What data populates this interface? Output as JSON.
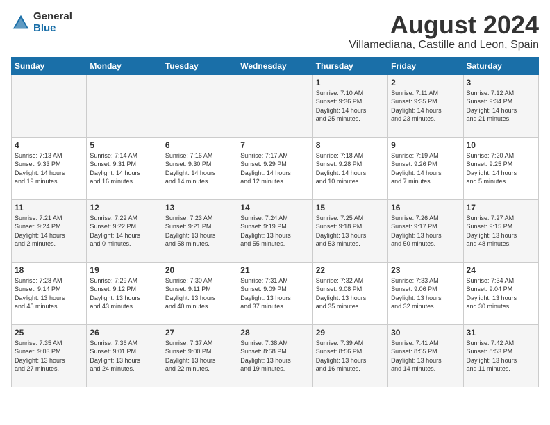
{
  "logo": {
    "general": "General",
    "blue": "Blue"
  },
  "title": {
    "month_year": "August 2024",
    "location": "Villamediana, Castille and Leon, Spain"
  },
  "headers": [
    "Sunday",
    "Monday",
    "Tuesday",
    "Wednesday",
    "Thursday",
    "Friday",
    "Saturday"
  ],
  "weeks": [
    [
      {
        "day": "",
        "info": ""
      },
      {
        "day": "",
        "info": ""
      },
      {
        "day": "",
        "info": ""
      },
      {
        "day": "",
        "info": ""
      },
      {
        "day": "1",
        "info": "Sunrise: 7:10 AM\nSunset: 9:36 PM\nDaylight: 14 hours\nand 25 minutes."
      },
      {
        "day": "2",
        "info": "Sunrise: 7:11 AM\nSunset: 9:35 PM\nDaylight: 14 hours\nand 23 minutes."
      },
      {
        "day": "3",
        "info": "Sunrise: 7:12 AM\nSunset: 9:34 PM\nDaylight: 14 hours\nand 21 minutes."
      }
    ],
    [
      {
        "day": "4",
        "info": "Sunrise: 7:13 AM\nSunset: 9:33 PM\nDaylight: 14 hours\nand 19 minutes."
      },
      {
        "day": "5",
        "info": "Sunrise: 7:14 AM\nSunset: 9:31 PM\nDaylight: 14 hours\nand 16 minutes."
      },
      {
        "day": "6",
        "info": "Sunrise: 7:16 AM\nSunset: 9:30 PM\nDaylight: 14 hours\nand 14 minutes."
      },
      {
        "day": "7",
        "info": "Sunrise: 7:17 AM\nSunset: 9:29 PM\nDaylight: 14 hours\nand 12 minutes."
      },
      {
        "day": "8",
        "info": "Sunrise: 7:18 AM\nSunset: 9:28 PM\nDaylight: 14 hours\nand 10 minutes."
      },
      {
        "day": "9",
        "info": "Sunrise: 7:19 AM\nSunset: 9:26 PM\nDaylight: 14 hours\nand 7 minutes."
      },
      {
        "day": "10",
        "info": "Sunrise: 7:20 AM\nSunset: 9:25 PM\nDaylight: 14 hours\nand 5 minutes."
      }
    ],
    [
      {
        "day": "11",
        "info": "Sunrise: 7:21 AM\nSunset: 9:24 PM\nDaylight: 14 hours\nand 2 minutes."
      },
      {
        "day": "12",
        "info": "Sunrise: 7:22 AM\nSunset: 9:22 PM\nDaylight: 14 hours\nand 0 minutes."
      },
      {
        "day": "13",
        "info": "Sunrise: 7:23 AM\nSunset: 9:21 PM\nDaylight: 13 hours\nand 58 minutes."
      },
      {
        "day": "14",
        "info": "Sunrise: 7:24 AM\nSunset: 9:19 PM\nDaylight: 13 hours\nand 55 minutes."
      },
      {
        "day": "15",
        "info": "Sunrise: 7:25 AM\nSunset: 9:18 PM\nDaylight: 13 hours\nand 53 minutes."
      },
      {
        "day": "16",
        "info": "Sunrise: 7:26 AM\nSunset: 9:17 PM\nDaylight: 13 hours\nand 50 minutes."
      },
      {
        "day": "17",
        "info": "Sunrise: 7:27 AM\nSunset: 9:15 PM\nDaylight: 13 hours\nand 48 minutes."
      }
    ],
    [
      {
        "day": "18",
        "info": "Sunrise: 7:28 AM\nSunset: 9:14 PM\nDaylight: 13 hours\nand 45 minutes."
      },
      {
        "day": "19",
        "info": "Sunrise: 7:29 AM\nSunset: 9:12 PM\nDaylight: 13 hours\nand 43 minutes."
      },
      {
        "day": "20",
        "info": "Sunrise: 7:30 AM\nSunset: 9:11 PM\nDaylight: 13 hours\nand 40 minutes."
      },
      {
        "day": "21",
        "info": "Sunrise: 7:31 AM\nSunset: 9:09 PM\nDaylight: 13 hours\nand 37 minutes."
      },
      {
        "day": "22",
        "info": "Sunrise: 7:32 AM\nSunset: 9:08 PM\nDaylight: 13 hours\nand 35 minutes."
      },
      {
        "day": "23",
        "info": "Sunrise: 7:33 AM\nSunset: 9:06 PM\nDaylight: 13 hours\nand 32 minutes."
      },
      {
        "day": "24",
        "info": "Sunrise: 7:34 AM\nSunset: 9:04 PM\nDaylight: 13 hours\nand 30 minutes."
      }
    ],
    [
      {
        "day": "25",
        "info": "Sunrise: 7:35 AM\nSunset: 9:03 PM\nDaylight: 13 hours\nand 27 minutes."
      },
      {
        "day": "26",
        "info": "Sunrise: 7:36 AM\nSunset: 9:01 PM\nDaylight: 13 hours\nand 24 minutes."
      },
      {
        "day": "27",
        "info": "Sunrise: 7:37 AM\nSunset: 9:00 PM\nDaylight: 13 hours\nand 22 minutes."
      },
      {
        "day": "28",
        "info": "Sunrise: 7:38 AM\nSunset: 8:58 PM\nDaylight: 13 hours\nand 19 minutes."
      },
      {
        "day": "29",
        "info": "Sunrise: 7:39 AM\nSunset: 8:56 PM\nDaylight: 13 hours\nand 16 minutes."
      },
      {
        "day": "30",
        "info": "Sunrise: 7:41 AM\nSunset: 8:55 PM\nDaylight: 13 hours\nand 14 minutes."
      },
      {
        "day": "31",
        "info": "Sunrise: 7:42 AM\nSunset: 8:53 PM\nDaylight: 13 hours\nand 11 minutes."
      }
    ]
  ]
}
